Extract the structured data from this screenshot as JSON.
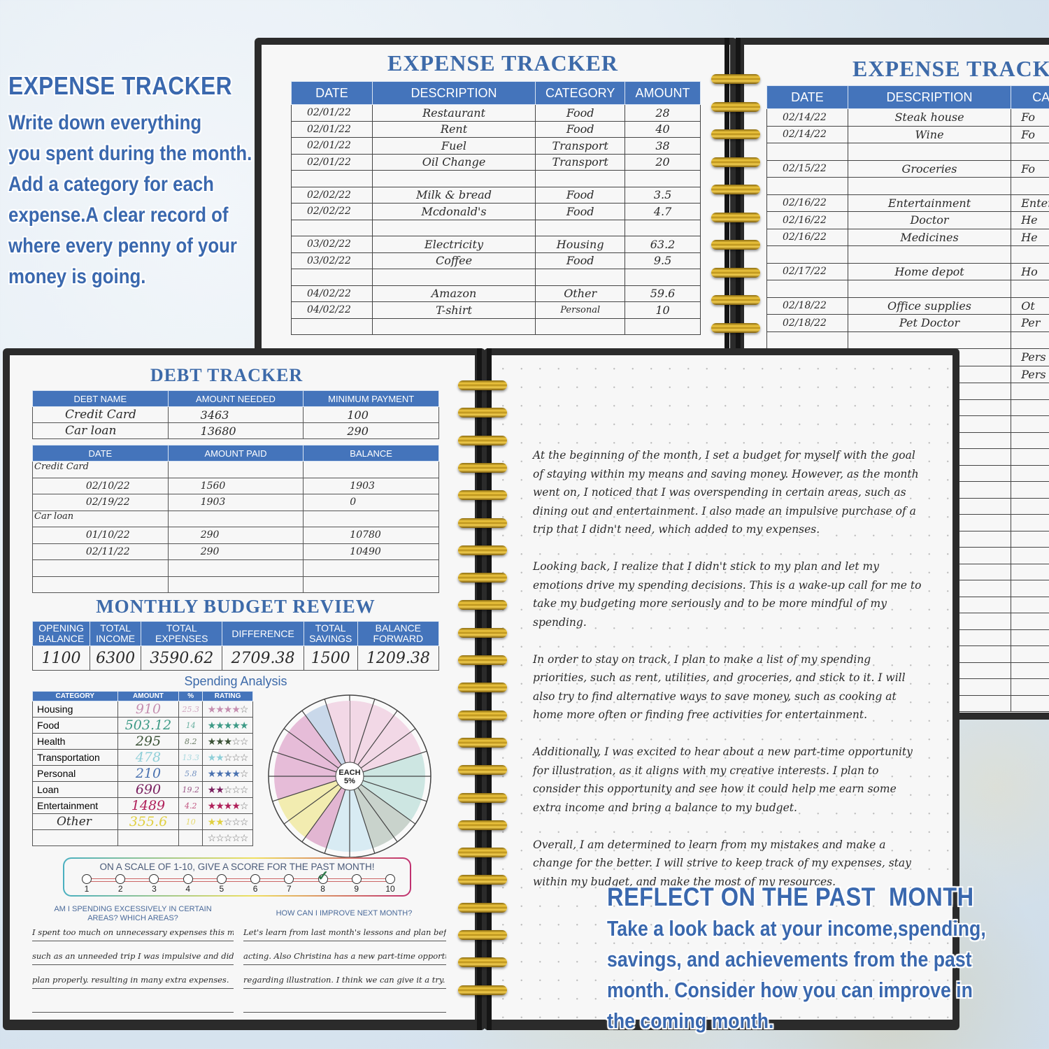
{
  "promo_left": {
    "title": "EXPENSE TRACKER",
    "lines": [
      "Write down everything",
      "you spent during the month.",
      "Add a category for each",
      "expense.A clear record of",
      "where every penny of your",
      "money is going."
    ]
  },
  "promo_right": {
    "title": "REFLECT ON THE PAST  MONTH",
    "lines": [
      "Take a look back at your income,spending,",
      "savings, and achievements from the past",
      "month. Consider how you can improve in",
      "the coming month."
    ]
  },
  "expense_page_1": {
    "title": "EXPENSE TRACKER",
    "headers": [
      "DATE",
      "DESCRIPTION",
      "CATEGORY",
      "AMOUNT"
    ],
    "rows": [
      [
        "02/01/22",
        "Restaurant",
        "Food",
        "28"
      ],
      [
        "02/01/22",
        "Rent",
        "Food",
        "40"
      ],
      [
        "02/01/22",
        "Fuel",
        "Transport",
        "38"
      ],
      [
        "02/01/22",
        "Oil Change",
        "Transport",
        "20"
      ],
      [
        "",
        "",
        "",
        ""
      ],
      [
        "02/02/22",
        "Milk & bread",
        "Food",
        "3.5"
      ],
      [
        "02/02/22",
        "Mcdonald's",
        "Food",
        "4.7"
      ],
      [
        "",
        "",
        "",
        ""
      ],
      [
        "03/02/22",
        "Electricity",
        "Housing",
        "63.2"
      ],
      [
        "03/02/22",
        "Coffee",
        "Food",
        "9.5"
      ],
      [
        "",
        "",
        "",
        ""
      ],
      [
        "04/02/22",
        "Amazon",
        "Other",
        "59.6"
      ],
      [
        "04/02/22",
        "T-shirt",
        "Personal",
        "10"
      ],
      [
        "",
        "",
        "",
        ""
      ]
    ]
  },
  "expense_page_2": {
    "title": "EXPENSE TRACKER",
    "headers": [
      "DATE",
      "DESCRIPTION",
      "CATEGORY"
    ],
    "rows": [
      [
        "02/14/22",
        "Steak house",
        "Fo"
      ],
      [
        "02/14/22",
        "Wine",
        "Fo"
      ],
      [
        "",
        "",
        ""
      ],
      [
        "02/15/22",
        "Groceries",
        "Fo"
      ],
      [
        "",
        "",
        ""
      ],
      [
        "02/16/22",
        "Entertainment",
        "Enter"
      ],
      [
        "02/16/22",
        "Doctor",
        "He"
      ],
      [
        "02/16/22",
        "Medicines",
        "He"
      ],
      [
        "",
        "",
        ""
      ],
      [
        "02/17/22",
        "Home depot",
        "Ho"
      ],
      [
        "",
        "",
        ""
      ],
      [
        "02/18/22",
        "Office supplies",
        "Ot"
      ],
      [
        "02/18/22",
        "Pet Doctor",
        "Per"
      ],
      [
        "",
        "",
        ""
      ],
      [
        "",
        "",
        "Pers"
      ],
      [
        "",
        "",
        "Pers"
      ]
    ]
  },
  "debt_tracker": {
    "title": "DEBT TRACKER",
    "summary_headers": [
      "DEBT NAME",
      "AMOUNT NEEDED",
      "MINIMUM PAYMENT"
    ],
    "summary_rows": [
      [
        "Credit Card",
        "3463",
        "100"
      ],
      [
        "Car loan",
        "13680",
        "290"
      ]
    ],
    "payment_headers": [
      "DATE",
      "AMOUNT PAID",
      "BALANCE"
    ],
    "payment_rows": [
      {
        "group": "Credit Card"
      },
      {
        "date": "02/10/22",
        "paid": "1560",
        "balance": "1903"
      },
      {
        "date": "02/19/22",
        "paid": "1903",
        "balance": "0"
      },
      {
        "group": "Car loan"
      },
      {
        "date": "01/10/22",
        "paid": "290",
        "balance": "10780"
      },
      {
        "date": "02/11/22",
        "paid": "290",
        "balance": "10490"
      },
      {
        "date": "",
        "paid": "",
        "balance": ""
      },
      {
        "date": "",
        "paid": "",
        "balance": ""
      }
    ]
  },
  "budget_review": {
    "title": "MONTHLY BUDGET REVIEW",
    "headers": [
      [
        "OPENING",
        "BALANCE"
      ],
      [
        "TOTAL",
        "INCOME"
      ],
      [
        "TOTAL",
        "EXPENSES"
      ],
      [
        "DIFFERENCE",
        ""
      ],
      [
        "TOTAL",
        "SAVINGS"
      ],
      [
        "BALANCE",
        "FORWARD"
      ]
    ],
    "values": [
      "1100",
      "6300",
      "3590.62",
      "2709.38",
      "1500",
      "1209.38"
    ]
  },
  "spending_analysis": {
    "title": "Spending Analysis",
    "headers": [
      "CATEGORY",
      "AMOUNT",
      "%",
      "RATING"
    ],
    "rows": [
      {
        "category": "Housing",
        "amount": "910",
        "pct": "25.3",
        "rating": 4,
        "color": "#c58fb0"
      },
      {
        "category": "Food",
        "amount": "503.12",
        "pct": "14",
        "rating": 5,
        "color": "#3d9a86"
      },
      {
        "category": "Health",
        "amount": "295",
        "pct": "8.2",
        "rating": 3,
        "color": "#3b5236"
      },
      {
        "category": "Transportation",
        "amount": "478",
        "pct": "13.3",
        "rating": 2,
        "color": "#8fcfd8"
      },
      {
        "category": "Personal",
        "amount": "210",
        "pct": "5.8",
        "rating": 4,
        "color": "#4a72b0"
      },
      {
        "category": "Loan",
        "amount": "690",
        "pct": "19.2",
        "rating": 2,
        "color": "#7a2060"
      },
      {
        "category": "Entertainment",
        "amount": "1489",
        "pct": "4.2",
        "rating": 4,
        "color": "#b0205a"
      },
      {
        "category": "Other",
        "amount": "355.6",
        "pct": "10",
        "rating": 2,
        "color": "#e0d040"
      },
      {
        "category": "",
        "amount": "",
        "pct": "",
        "rating": 0,
        "color": "#888888"
      }
    ],
    "wheel_label": [
      "EACH",
      "5%"
    ],
    "wheel_segment_colors": [
      "#f2d8e6",
      "#f2d8e6",
      "#f2d8e6",
      "#f2d8e6",
      "#cde6e2",
      "#cde6e2",
      "#cde6e2",
      "#c9d3cc",
      "#c9d3cc",
      "#d8ebf3",
      "#d8ebf3",
      "#e2b6d2",
      "#f2ecb0",
      "#f2ecb0",
      "#e6bcd8",
      "#e6bcd8",
      "#e6bcd8",
      "#e6bcd8",
      "#c9d8ea",
      "#f2d8e6"
    ]
  },
  "score": {
    "prompt": "ON A SCALE OF 1-10, GIVE A SCORE FOR THE PAST MONTH!",
    "labels": [
      "1",
      "2",
      "3",
      "4",
      "5",
      "6",
      "7",
      "8",
      "9",
      "10"
    ],
    "selected": 8
  },
  "questions": {
    "q1": [
      "AM I SPENDING EXCESSIVELY IN CERTAIN",
      "AREAS? WHICH AREAS?"
    ],
    "q1_answer": [
      "I spent too much on unnecessary expenses this month.",
      "such as an unneeded trip I was impulsive and didn't",
      "plan properly. resulting in many extra expenses.",
      ""
    ],
    "q2": "HOW CAN I IMPROVE NEXT MONTH?",
    "q2_answer": [
      "Let's learn from last month's lessons and plan before",
      "acting. Also Christina has a new part-time opportunity",
      "regarding illustration. I think we can give it a try.",
      ""
    ]
  },
  "reflection": {
    "paragraphs": [
      "At the beginning of the month, I set a budget for myself with the goal of staying within my means and saving money. However, as the month went on, I noticed that I was overspending in certain areas, such as dining out and entertainment. I also made an impulsive purchase of a trip that I didn't need, which added to my expenses.",
      "Looking back, I realize that I didn't stick to my plan and let my emotions drive my spending decisions. This is a wake-up call for me to take my budgeting more seriously and to be more mindful of my spending.",
      "In order to stay on track, I plan to make a list of my spending priorities, such as rent, utilities, and groceries, and stick to it. I will also try to find alternative ways to save money, such as cooking at home more often or finding free activities for entertainment.",
      "Additionally, I was excited to hear about a new part-time opportunity for illustration, as it aligns with my creative interests. I plan to consider this opportunity and see how it could help me earn some extra income and bring a balance to my budget.",
      "Overall, I am determined to learn from my mistakes and make a change for the better. I will strive to keep track of my expenses, stay within my budget, and make the most of my resources."
    ]
  }
}
